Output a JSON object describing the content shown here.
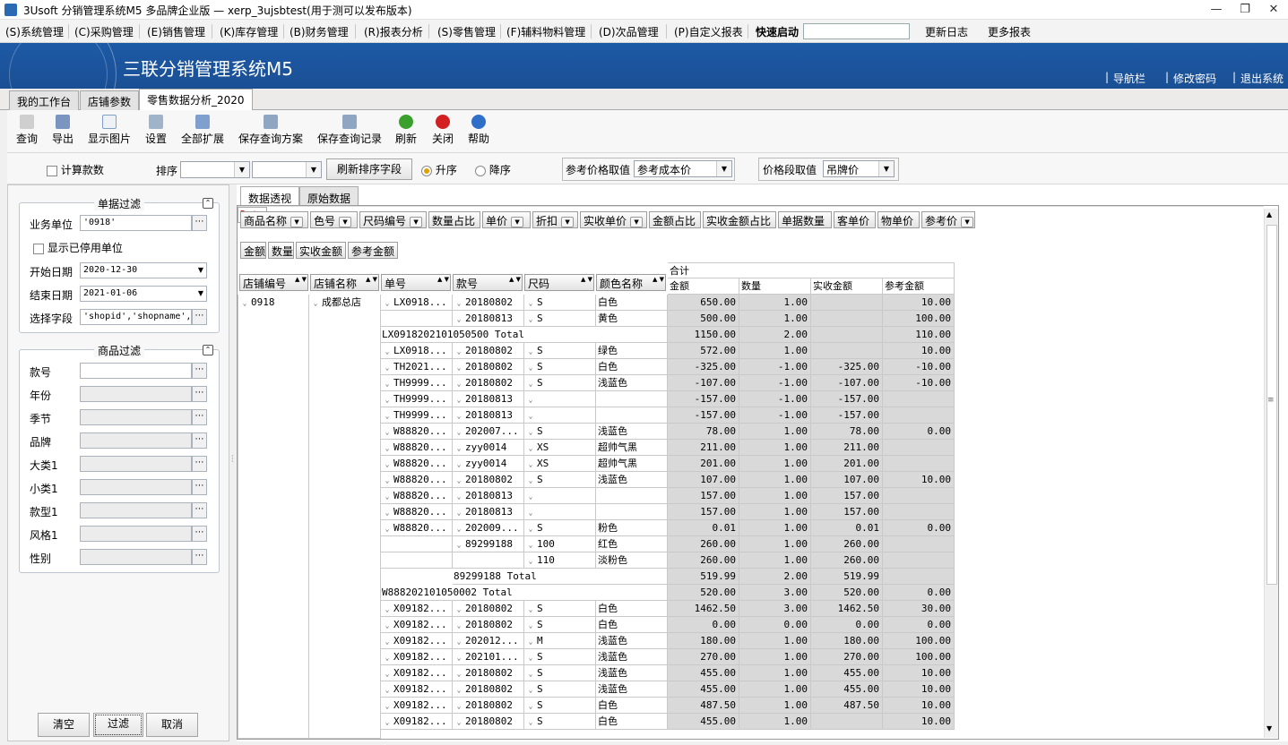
{
  "window": {
    "title": "3Usoft 分销管理系统M5 多品牌企业版 — xerp_3ujsbtest(用于测可以发布版本)",
    "min": "—",
    "restore": "❐",
    "close": "✕"
  },
  "menu": {
    "items": [
      "(S)系统管理",
      "(C)采购管理",
      "(E)销售管理",
      "(K)库存管理",
      "(B)财务管理",
      "(R)报表分析",
      "(S)零售管理",
      "(F)辅料物料管理",
      "(D)次品管理",
      "(P)自定义报表"
    ],
    "quick_start": "快速启动",
    "changelog": "更新日志",
    "more_reports": "更多报表"
  },
  "banner": {
    "title": "三联分销管理系统M5",
    "links": [
      "导航栏",
      "修改密码",
      "退出系统"
    ]
  },
  "tabs": [
    "我的工作台",
    "店铺参数",
    "零售数据分析_2020"
  ],
  "toolbar": [
    "查询",
    "导出",
    "显示图片",
    "设置",
    "全部扩展",
    "保存查询方案",
    "保存查询记录",
    "刷新",
    "关闭",
    "帮助"
  ],
  "options": {
    "calc_count": "计算款数",
    "sort_label": "排序",
    "refresh_sort": "刷新排序字段",
    "asc": "升序",
    "desc": "降序",
    "ref_price_label": "参考价格取值",
    "ref_price_value": "参考成本价",
    "price_band_label": "价格段取值",
    "price_band_value": "吊牌价"
  },
  "doc_filter": {
    "title": "单据过滤",
    "unit_label": "业务单位",
    "unit_value": "'0918'",
    "show_disabled": "显示已停用单位",
    "start_label": "开始日期",
    "start_value": "2020-12-30",
    "end_label": "结束日期",
    "end_value": "2021-01-06",
    "fields_label": "选择字段",
    "fields_value": "'shopid','shopname','"
  },
  "goods_filter": {
    "title": "商品过滤",
    "fields": [
      "款号",
      "年份",
      "季节",
      "品牌",
      "大类1",
      "小类1",
      "款型1",
      "风格1",
      "性别"
    ]
  },
  "buttons": {
    "clear": "清空",
    "filter": "过滤",
    "cancel": "取消"
  },
  "right_tabs": [
    "数据透视",
    "原始数据"
  ],
  "pivot": {
    "filter_fields": [
      "商品名称",
      "色号",
      "尺码编号",
      "数量占比",
      "单价",
      "折扣",
      "实收单价",
      "金额占比",
      "实收金额占比",
      "单据数量",
      "客单价",
      "物单价",
      "参考价"
    ],
    "data_fields": [
      "金额",
      "数量",
      "实收金额",
      "参考金额"
    ],
    "data_label": "Data",
    "row_headers": [
      "店铺编号",
      "店铺名称",
      "单号",
      "款号",
      "尺码",
      "颜色名称"
    ],
    "total_label": "合计",
    "value_headers": [
      "金额",
      "数量",
      "实收金额",
      "参考金额"
    ],
    "shop_id": "0918",
    "shop_name": "成都总店",
    "rows": [
      {
        "doc": "LX0918...",
        "style": "20180802",
        "size": "S",
        "color": "白色",
        "amt": "650.00",
        "qty": "1.00",
        "real": "",
        "ref": "10.00"
      },
      {
        "doc": "",
        "style": "20180813",
        "size": "S",
        "color": "黄色",
        "amt": "500.00",
        "qty": "1.00",
        "real": "",
        "ref": "100.00"
      },
      {
        "total": "LX0918202101050500 Total",
        "level": "doc",
        "amt": "1150.00",
        "qty": "2.00",
        "real": "",
        "ref": "110.00"
      },
      {
        "doc": "LX0918...",
        "style": "20180802",
        "size": "S",
        "color": "绿色",
        "amt": "572.00",
        "qty": "1.00",
        "real": "",
        "ref": "10.00"
      },
      {
        "doc": "TH2021...",
        "style": "20180802",
        "size": "S",
        "color": "白色",
        "amt": "-325.00",
        "qty": "-1.00",
        "real": "-325.00",
        "ref": "-10.00"
      },
      {
        "doc": "TH9999...",
        "style": "20180802",
        "size": "S",
        "color": "浅蓝色",
        "amt": "-107.00",
        "qty": "-1.00",
        "real": "-107.00",
        "ref": "-10.00"
      },
      {
        "doc": "TH9999...",
        "style": "20180813",
        "size": "",
        "color": "",
        "amt": "-157.00",
        "qty": "-1.00",
        "real": "-157.00",
        "ref": ""
      },
      {
        "doc": "TH9999...",
        "style": "20180813",
        "size": "",
        "color": "",
        "amt": "-157.00",
        "qty": "-1.00",
        "real": "-157.00",
        "ref": ""
      },
      {
        "doc": "W88820...",
        "style": "202007...",
        "size": "S",
        "color": "浅蓝色",
        "amt": "78.00",
        "qty": "1.00",
        "real": "78.00",
        "ref": "0.00"
      },
      {
        "doc": "W88820...",
        "style": "zyy0014",
        "size": "XS",
        "color": "超帅气黑",
        "amt": "211.00",
        "qty": "1.00",
        "real": "211.00",
        "ref": ""
      },
      {
        "doc": "W88820...",
        "style": "zyy0014",
        "size": "XS",
        "color": "超帅气黑",
        "amt": "201.00",
        "qty": "1.00",
        "real": "201.00",
        "ref": ""
      },
      {
        "doc": "W88820...",
        "style": "20180802",
        "size": "S",
        "color": "浅蓝色",
        "amt": "107.00",
        "qty": "1.00",
        "real": "107.00",
        "ref": "10.00"
      },
      {
        "doc": "W88820...",
        "style": "20180813",
        "size": "",
        "color": "",
        "amt": "157.00",
        "qty": "1.00",
        "real": "157.00",
        "ref": ""
      },
      {
        "doc": "W88820...",
        "style": "20180813",
        "size": "",
        "color": "",
        "amt": "157.00",
        "qty": "1.00",
        "real": "157.00",
        "ref": ""
      },
      {
        "doc": "W88820...",
        "style": "202009...",
        "size": "S",
        "color": "粉色",
        "amt": "0.01",
        "qty": "1.00",
        "real": "0.01",
        "ref": "0.00"
      },
      {
        "doc": "",
        "style": "89299188",
        "size": "100",
        "color": "红色",
        "amt": "260.00",
        "qty": "1.00",
        "real": "260.00",
        "ref": ""
      },
      {
        "doc": "",
        "style": "",
        "size": "110",
        "color": "淡粉色",
        "amt": "260.00",
        "qty": "1.00",
        "real": "260.00",
        "ref": ""
      },
      {
        "total": "89299188 Total",
        "level": "style",
        "amt": "519.99",
        "qty": "2.00",
        "real": "519.99",
        "ref": ""
      },
      {
        "total": "W888202101050002 Total",
        "level": "doc",
        "amt": "520.00",
        "qty": "3.00",
        "real": "520.00",
        "ref": "0.00"
      },
      {
        "doc": "X09182...",
        "style": "20180802",
        "size": "S",
        "color": "白色",
        "amt": "1462.50",
        "qty": "3.00",
        "real": "1462.50",
        "ref": "30.00"
      },
      {
        "doc": "X09182...",
        "style": "20180802",
        "size": "S",
        "color": "白色",
        "amt": "0.00",
        "qty": "0.00",
        "real": "0.00",
        "ref": "0.00"
      },
      {
        "doc": "X09182...",
        "style": "202012...",
        "size": "M",
        "color": "浅蓝色",
        "amt": "180.00",
        "qty": "1.00",
        "real": "180.00",
        "ref": "100.00"
      },
      {
        "doc": "X09182...",
        "style": "202101...",
        "size": "S",
        "color": "浅蓝色",
        "amt": "270.00",
        "qty": "1.00",
        "real": "270.00",
        "ref": "100.00"
      },
      {
        "doc": "X09182...",
        "style": "20180802",
        "size": "S",
        "color": "浅蓝色",
        "amt": "455.00",
        "qty": "1.00",
        "real": "455.00",
        "ref": "10.00"
      },
      {
        "doc": "X09182...",
        "style": "20180802",
        "size": "S",
        "color": "浅蓝色",
        "amt": "455.00",
        "qty": "1.00",
        "real": "455.00",
        "ref": "10.00"
      },
      {
        "doc": "X09182...",
        "style": "20180802",
        "size": "S",
        "color": "白色",
        "amt": "487.50",
        "qty": "1.00",
        "real": "487.50",
        "ref": "10.00"
      },
      {
        "doc": "X09182...",
        "style": "20180802",
        "size": "S",
        "color": "白色",
        "amt": "455.00",
        "qty": "1.00",
        "real": "",
        "ref": "10.00"
      }
    ]
  },
  "icon_names": {
    "query": "query-icon",
    "export": "export-icon",
    "image": "image-icon",
    "settings": "gear-icon",
    "expand": "tree-icon",
    "save_plan": "save-plan-icon",
    "save_rec": "save-record-icon",
    "refresh": "refresh-icon",
    "close": "close-icon",
    "help": "help-icon"
  },
  "colors": {
    "banner": "#1d5aa6",
    "data_label": "#d00000",
    "refresh": "#3aa02c",
    "close": "#d22020",
    "help": "#2f6fc9"
  }
}
